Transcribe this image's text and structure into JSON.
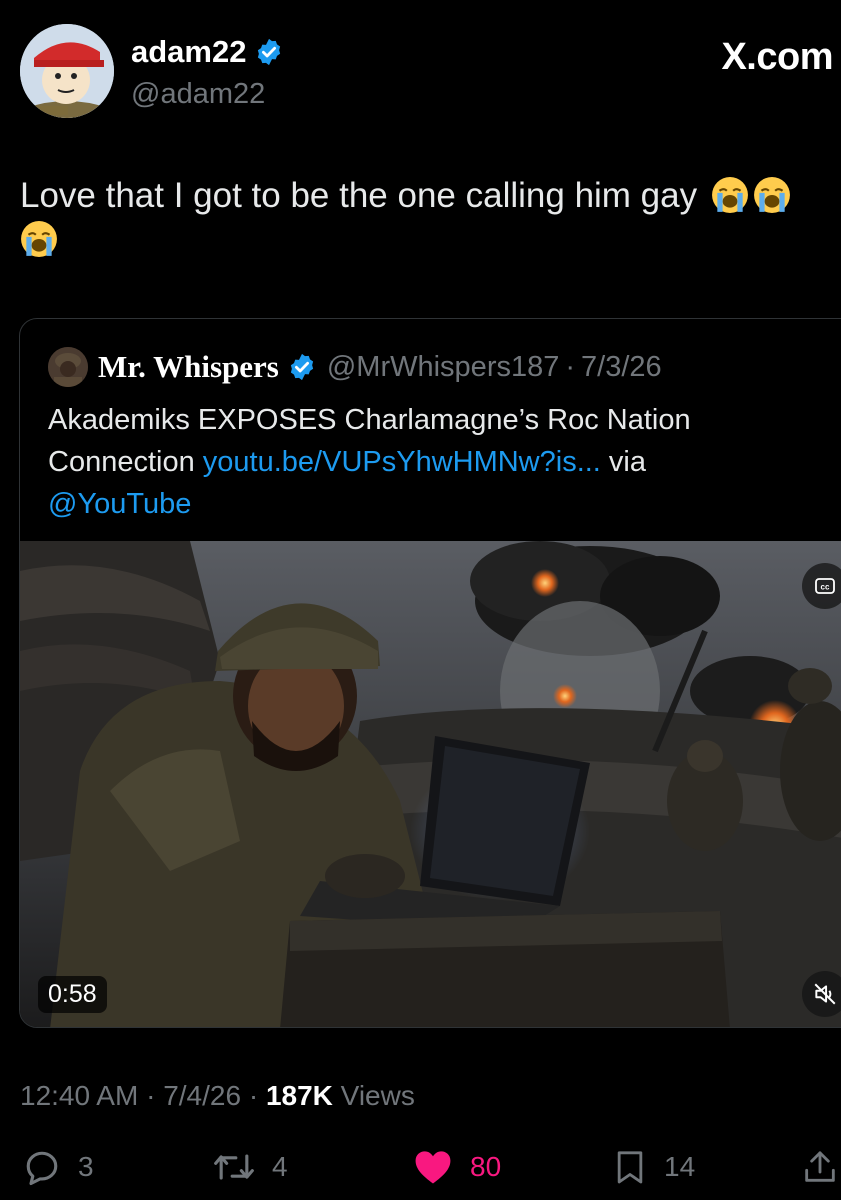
{
  "author": {
    "display_name": "adam22",
    "handle": "@adam22",
    "verified": true,
    "avatar_icon": "cartoon-avatar-icon"
  },
  "brand": "X.com",
  "tweet": {
    "text": "Love that I got to be the one calling him gay",
    "emoji": [
      "loudly-crying-face",
      "loudly-crying-face",
      "loudly-crying-face"
    ]
  },
  "quote": {
    "display_name": "Mr. Whispers",
    "verified": true,
    "handle": "@MrWhispers187",
    "separator": "·",
    "date": "7/3/26",
    "text_part1": "Akademiks EXPOSES Charlamagne’s Roc Nation Connection ",
    "link": "youtu.be/VUPsYhwHMNw?is...",
    "text_part2": " via ",
    "mention": "@YouTube",
    "video": {
      "duration": "0:58",
      "cc_icon": "closed-captions-icon",
      "mute_icon": "muted-speaker-icon"
    }
  },
  "meta": {
    "time": "12:40 AM",
    "dot1": " · ",
    "date": "7/4/26",
    "dot2": " · ",
    "views_count": "187K",
    "views_label": " Views"
  },
  "actions": {
    "replies": "3",
    "reposts": "4",
    "likes": "80",
    "bookmarks": "14"
  },
  "colors": {
    "background": "#000000",
    "link": "#1d9bf0",
    "verified": "#1d9bf0",
    "like": "#f91880",
    "muted_text": "#71767b"
  }
}
